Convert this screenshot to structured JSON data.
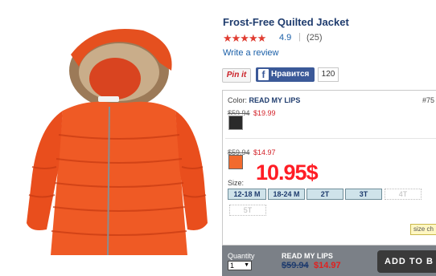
{
  "product": {
    "title": "Frost-Free Quilted Jacket",
    "stars": "★★★★★",
    "rating": "4.9",
    "separator": "|",
    "reviews": "(25)",
    "write_review": "Write a review"
  },
  "social": {
    "pin_label": "Pin it",
    "fb_icon": "f",
    "fb_label": "Нравится",
    "fb_count": "120"
  },
  "options": {
    "color_prefix": "Color:",
    "color_name": "READ MY LIPS",
    "sku": "#75",
    "swatch1": {
      "was": "$59.94",
      "now": "$19.99",
      "color": "#2a2a2a"
    },
    "swatch2": {
      "was": "$59.94",
      "now": "$14.97",
      "color": "#f26a2e"
    },
    "overlay_price": "10.95$",
    "size_label": "Size:",
    "sizes": [
      {
        "label": "12-18 M",
        "available": true
      },
      {
        "label": "18-24 M",
        "available": true
      },
      {
        "label": "2T",
        "available": true
      },
      {
        "label": "3T",
        "available": true
      },
      {
        "label": "4T",
        "available": false
      },
      {
        "label": "5T",
        "available": false
      }
    ],
    "size_chart": "size ch"
  },
  "purchase": {
    "qty_label": "Quantity",
    "qty_value": "1",
    "qty_arrow": "▼",
    "color_name": "READ MY LIPS",
    "was": "$59.94",
    "now": "$14.97",
    "add_label": "ADD TO B"
  },
  "colors": {
    "brand_blue": "#1f3c6e",
    "sale_red": "#d31f26",
    "accent_orange": "#f26a2e"
  }
}
